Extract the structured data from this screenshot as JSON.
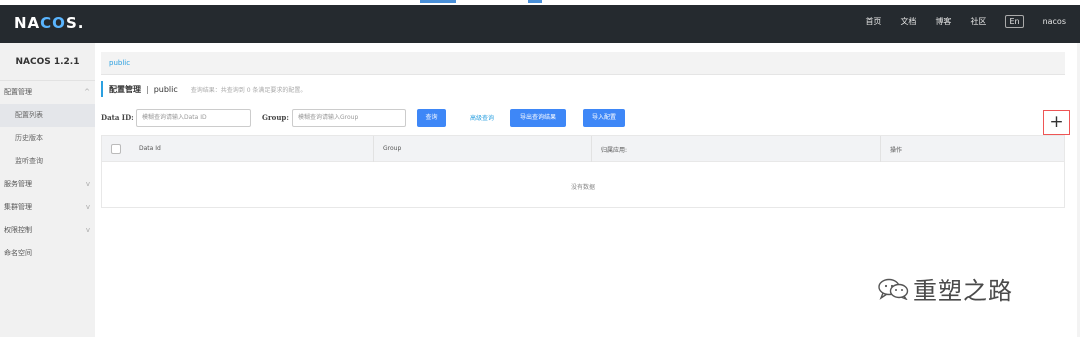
{
  "topbar": {
    "logo": "NACOS",
    "nav": [
      "首页",
      "文档",
      "博客",
      "社区"
    ],
    "lang": "En",
    "user": "nacos"
  },
  "sidebar": {
    "version": "NACOS 1.2.1",
    "items": [
      {
        "label": "配置管理",
        "arrow": "^"
      },
      {
        "label": "配置列表"
      },
      {
        "label": "历史版本"
      },
      {
        "label": "监听查询"
      },
      {
        "label": "服务管理",
        "arrow": "v"
      },
      {
        "label": "集群管理",
        "arrow": "v"
      },
      {
        "label": "权限控制",
        "arrow": "v"
      },
      {
        "label": "命名空间"
      }
    ]
  },
  "namespace_bar": {
    "label": "public"
  },
  "page_title": {
    "title": "配置管理",
    "separator": "|",
    "namespace": "public",
    "hint": "查询结果：共查询到 0 条满足要求的配置。"
  },
  "search": {
    "data_id_label": "Data ID:",
    "data_id_placeholder": "模糊查询请输入Data ID",
    "group_label": "Group:",
    "group_placeholder": "模糊查询请输入Group",
    "query_button": "查询",
    "advanced_link": "高级查询",
    "export_button": "导出查询结果",
    "import_button": "导入配置",
    "add_button": "+"
  },
  "table": {
    "columns": [
      "Data Id",
      "Group",
      "归属应用:",
      "操作"
    ],
    "empty_text": "没有数据"
  },
  "watermark": {
    "text": "重塑之路"
  },
  "colors": {
    "topbar": "#252a2f",
    "primary_button": "#3e87f7",
    "link": "#2ba0e0",
    "add_border": "#e55555"
  }
}
